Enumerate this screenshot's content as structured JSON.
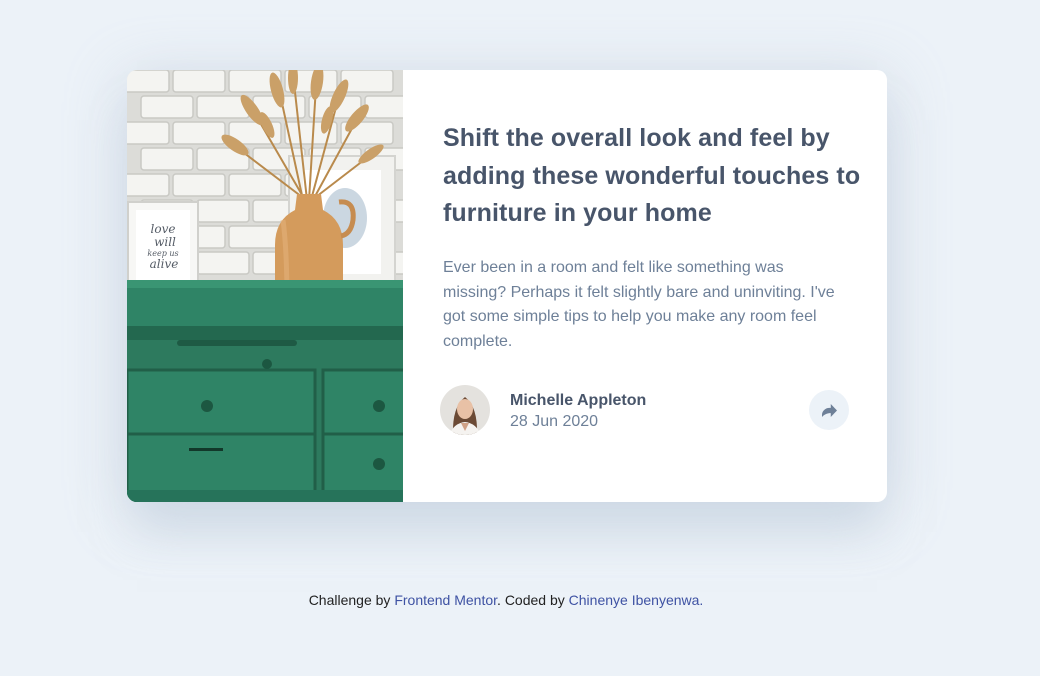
{
  "article": {
    "title": "Shift the overall look and feel by adding these wonderful touches to furniture in your home",
    "excerpt": "Ever been in a room and felt like something was missing? Perhaps it felt slightly bare and uninviting. I've got some simple tips to help you make any room feel complete.",
    "author_name": "Michelle Appleton",
    "date": "28 Jun 2020",
    "share_icon": "share-icon"
  },
  "photo_frame_text": [
    "love",
    "will",
    "keep us",
    "alive"
  ],
  "attribution": {
    "prefix": "Challenge by ",
    "link1": "Frontend Mentor",
    "middle": ". Coded by ",
    "link2": "Chinenye Ibenyenwa."
  },
  "colors": {
    "background": "#ecf2f8",
    "heading": "#48556a",
    "body_text": "#6e8098",
    "link": "#3e52a3",
    "dresser": "#2f8466"
  }
}
